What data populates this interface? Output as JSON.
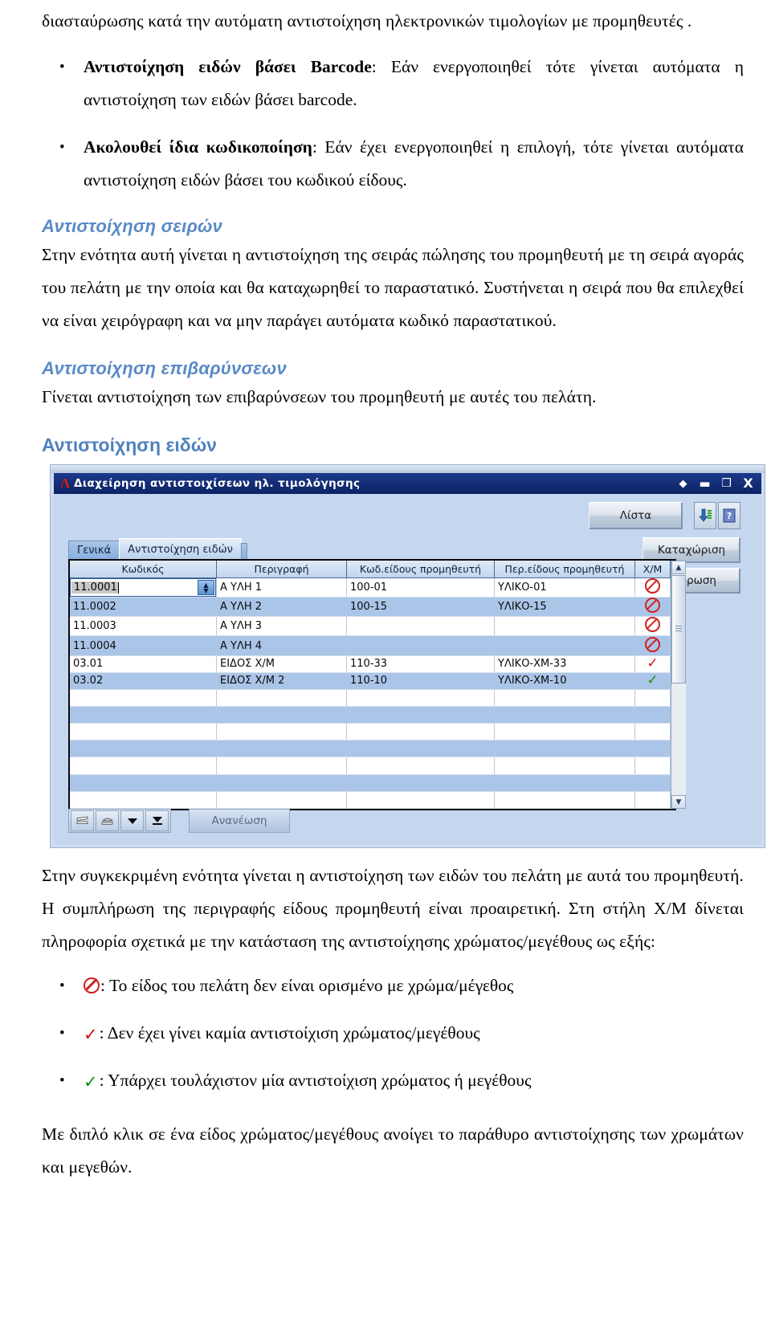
{
  "document": {
    "intro_continuation": "διασταύρωσης κατά την αυτόματη αντιστοίχηση ηλεκτρονικών τιμολογίων με προμηθευτές .",
    "bullets_top": [
      {
        "lead": "Αντιστοίχηση ειδών βάσει Barcode",
        "text": ": Εάν ενεργοποιηθεί τότε γίνεται αυτόματα η αντιστοίχηση των ειδών βάσει barcode."
      },
      {
        "lead": "Ακολουθεί ίδια κωδικοποίηση",
        "text": ": Εάν έχει ενεργοποιηθεί η επιλογή, τότε γίνεται αυτόματα αντιστοίχηση ειδών βάσει του κωδικού είδους."
      }
    ],
    "section_seires": {
      "heading": "Αντιστοίχηση σειρών",
      "paragraph": "Στην ενότητα αυτή γίνεται η αντιστοίχηση της σειράς πώλησης του προμηθευτή με τη σειρά αγοράς του πελάτη με την οποία και θα καταχωρηθεί το παραστατικό. Συστήνεται η σειρά που θα επιλεχθεί να είναι χειρόγραφη και να μην παράγει αυτόματα κωδικό παραστατικού."
    },
    "section_epivarinseon": {
      "heading": "Αντιστοίχηση επιβαρύνσεων",
      "paragraph": "Γίνεται αντιστοίχηση των επιβαρύνσεων του προμηθευτή με αυτές του πελάτη."
    },
    "section_eidon": {
      "heading": "Αντιστοίχηση ειδών",
      "paragraph": "Στην συγκεκριμένη ενότητα γίνεται η αντιστοίχηση των ειδών του πελάτη με αυτά του προμηθευτή. Η συμπλήρωση της περιγραφής είδους προμηθευτή είναι προαιρετική. Στη στήλη Χ/Μ δίνεται πληροφορία σχετικά με την κατάσταση της αντιστοίχησης χρώματος/μεγέθους ως εξής:",
      "legend": [
        {
          "icon": "no-entry-icon",
          "text": ": Το είδος του πελάτη δεν είναι ορισμένο με χρώμα/μέγεθος"
        },
        {
          "icon": "red-check-icon",
          "text": ": Δεν έχει γίνει καμία αντιστοίχιση χρώματος/μεγέθους"
        },
        {
          "icon": "green-check-icon",
          "text": ": Υπάρχει τουλάχιστον μία αντιστοίχιση χρώματος ή μεγέθους"
        }
      ],
      "closing": "Με διπλό κλικ σε ένα είδος χρώματος/μεγέθους ανοίγει το παράθυρο αντιστοίχησης των χρωμάτων και μεγεθών."
    }
  },
  "app_window": {
    "logo": "Λ",
    "title": "Διαχείρηση αντιστοιχίσεων ηλ. τιμολόγησης",
    "controls": {
      "restore": "◆",
      "minimize": "▬",
      "maximize": "❒",
      "close": "X"
    },
    "toolbar": {
      "list_button": "Λίστα",
      "export_icon": "download-icon",
      "help_icon": "help-icon"
    },
    "actions": {
      "submit": "Καταχώριση",
      "cancel": "Ακύρωση"
    },
    "tabs": [
      {
        "label": "Γενικά",
        "active": false
      },
      {
        "label": "Αντιστοίχηση ειδών",
        "active": true
      }
    ],
    "grid": {
      "columns": [
        "Κωδικός",
        "Περιγραφή",
        "Κωδ.είδους προμηθευτή",
        "Περ.είδους προμηθευτή",
        "Χ/Μ"
      ],
      "rows": [
        {
          "kodikos": "11.0001",
          "perigrafi": "Α ΥΛΗ 1",
          "kod_prom": "100-01",
          "per_prom": "ΥΛΙΚΟ-01",
          "xm": "no-entry-icon",
          "editing": true
        },
        {
          "kodikos": "11.0002",
          "perigrafi": "Α ΥΛΗ 2",
          "kod_prom": "100-15",
          "per_prom": "ΥΛΙΚΟ-15",
          "xm": "no-entry-icon",
          "editing": false
        },
        {
          "kodikos": "11.0003",
          "perigrafi": "Α ΥΛΗ 3",
          "kod_prom": "",
          "per_prom": "",
          "xm": "no-entry-icon",
          "editing": false
        },
        {
          "kodikos": "11.0004",
          "perigrafi": "Α ΥΛΗ 4",
          "kod_prom": "",
          "per_prom": "",
          "xm": "no-entry-icon",
          "editing": false
        },
        {
          "kodikos": "03.01",
          "perigrafi": "ΕΙΔΟΣ Χ/Μ",
          "kod_prom": "110-33",
          "per_prom": "ΥΛΙΚΟ-ΧΜ-33",
          "xm": "red-check-icon",
          "editing": false
        },
        {
          "kodikos": "03.02",
          "perigrafi": "ΕΙΔΟΣ Χ/Μ 2",
          "kod_prom": "110-10",
          "per_prom": "ΥΛΙΚΟ-ΧΜ-10",
          "xm": "green-check-icon",
          "editing": false
        },
        {
          "kodikos": "",
          "perigrafi": "",
          "kod_prom": "",
          "per_prom": "",
          "xm": "",
          "editing": false
        },
        {
          "kodikos": "",
          "perigrafi": "",
          "kod_prom": "",
          "per_prom": "",
          "xm": "",
          "editing": false
        },
        {
          "kodikos": "",
          "perigrafi": "",
          "kod_prom": "",
          "per_prom": "",
          "xm": "",
          "editing": false
        },
        {
          "kodikos": "",
          "perigrafi": "",
          "kod_prom": "",
          "per_prom": "",
          "xm": "",
          "editing": false
        },
        {
          "kodikos": "",
          "perigrafi": "",
          "kod_prom": "",
          "per_prom": "",
          "xm": "",
          "editing": false
        },
        {
          "kodikos": "",
          "perigrafi": "",
          "kod_prom": "",
          "per_prom": "",
          "xm": "",
          "editing": false
        },
        {
          "kodikos": "",
          "perigrafi": "",
          "kod_prom": "",
          "per_prom": "",
          "xm": "",
          "editing": false
        }
      ],
      "edit_value": "11.0001"
    },
    "navbar": {
      "buttons": [
        "insert-record-icon",
        "delete-record-icon",
        "next-record-icon",
        "last-record-icon"
      ],
      "refresh": "Ανανέωση"
    },
    "scrollbar": {
      "up": "▲",
      "down": "▼"
    }
  }
}
